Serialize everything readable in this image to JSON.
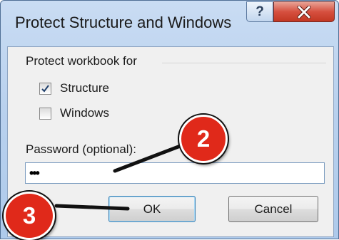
{
  "window": {
    "title": "Protect Structure and Windows",
    "help_glyph": "?",
    "close_glyph": "X"
  },
  "group": {
    "label": "Protect workbook for",
    "structure": {
      "label": "Structure",
      "checked": true
    },
    "windows": {
      "label": "Windows",
      "checked": false
    }
  },
  "password": {
    "label": "Password (optional):",
    "value": "•••"
  },
  "buttons": {
    "ok_label": "OK",
    "cancel_label": "Cancel"
  },
  "callouts": {
    "step2": "2",
    "step3": "3",
    "color": "#e0291a"
  }
}
